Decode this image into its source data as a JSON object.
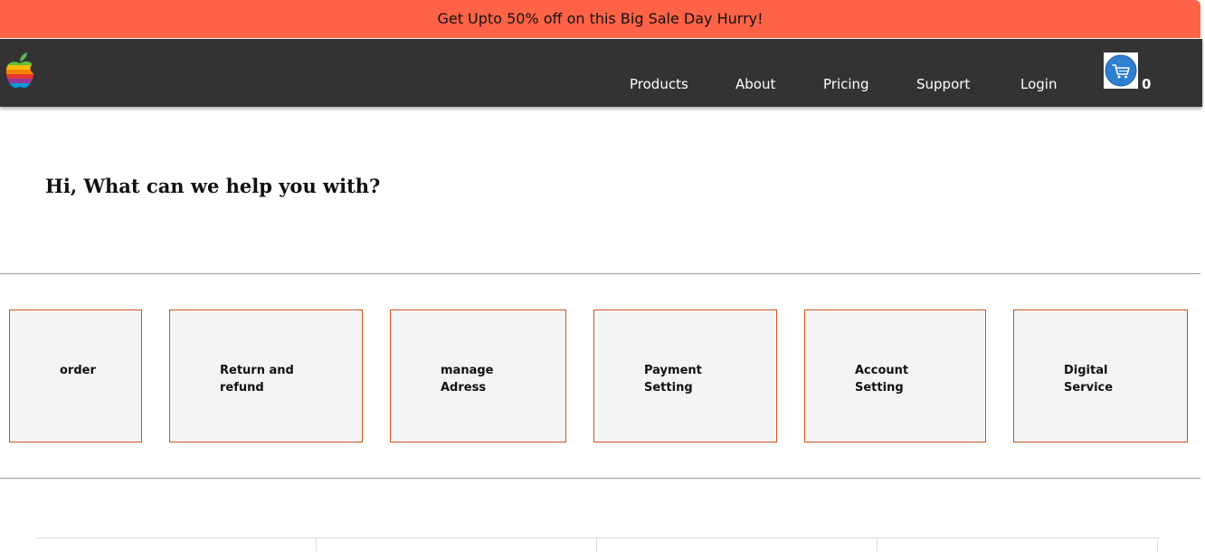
{
  "promo": {
    "text": "Get Upto 50% off on this Big Sale Day Hurry!"
  },
  "nav": {
    "logo_icon": "apple-rainbow-logo",
    "links": [
      {
        "label": "Products"
      },
      {
        "label": "About"
      },
      {
        "label": "Pricing"
      },
      {
        "label": "Support"
      },
      {
        "label": "Login"
      }
    ],
    "cart_icon": "shopping-cart-icon",
    "cart_count": "0"
  },
  "main": {
    "heading": "Hi, What can we help you with?",
    "cards": [
      {
        "label": "order"
      },
      {
        "label": "Return and refund"
      },
      {
        "label": "manage Adress"
      },
      {
        "label": "Payment Setting"
      },
      {
        "label": "Account Setting"
      },
      {
        "label": "Digital Service"
      }
    ]
  },
  "colors": {
    "promo_bg": "#ff6347",
    "navbar_bg": "#333333",
    "card_border": "#d2551c",
    "card_bg": "#f4f4f4",
    "cart_blue": "#2f7fd1"
  }
}
